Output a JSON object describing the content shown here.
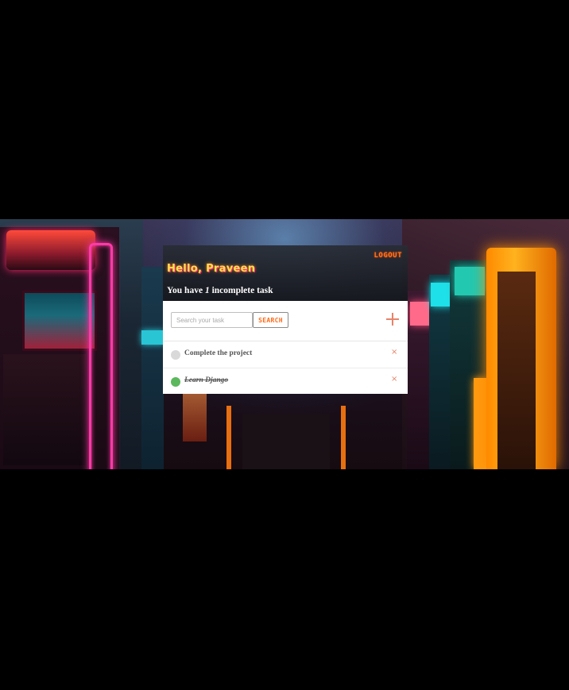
{
  "header": {
    "logout_label": "LOGOUT",
    "greeting": "Hello, Praveen",
    "count_prefix": "You have ",
    "count_value": "1",
    "count_suffix": " incomplete task"
  },
  "search": {
    "placeholder": "Search your task",
    "value": "",
    "button_label": "SEARCH"
  },
  "add": {
    "icon": "plus-icon"
  },
  "tasks": [
    {
      "title": "Complete the project",
      "completed": false,
      "delete_glyph": "×"
    },
    {
      "title": "Learn Django",
      "completed": true,
      "delete_glyph": "×"
    }
  ],
  "colors": {
    "accent": "#ff7a1a",
    "greeting": "#ffe24a",
    "complete": "#5cb85c",
    "incomplete": "#d9d9d9",
    "delete": "#e8836a"
  }
}
